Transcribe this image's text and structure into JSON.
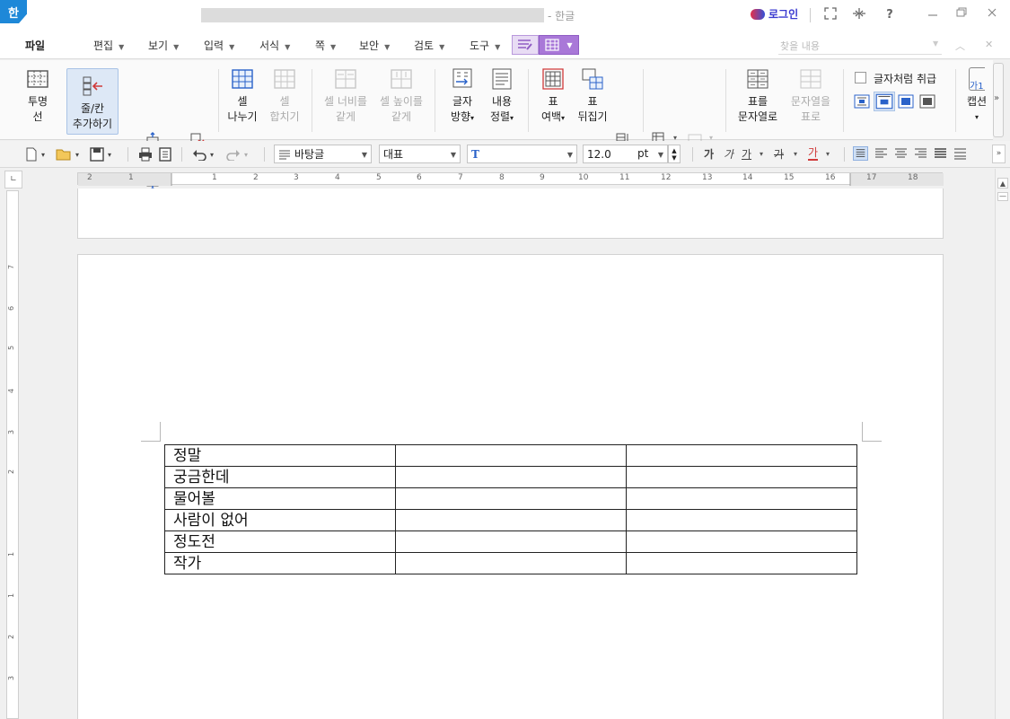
{
  "titlebar": {
    "app_icon": "한",
    "title_suffix": "- 한글",
    "login_label": "로그인",
    "buttons": [
      "fullscreen-icon",
      "pin-icon",
      "help-icon",
      "minimize-icon",
      "restore-icon",
      "close-icon"
    ],
    "help_glyph": "?"
  },
  "menu": {
    "file": "파일",
    "items": [
      "편집",
      "보기",
      "입력",
      "서식",
      "쪽",
      "보안",
      "검토",
      "도구"
    ],
    "search_placeholder": "찾을 내용"
  },
  "ribbon": {
    "transparent": [
      "투명",
      "선"
    ],
    "add_row_col": [
      "줄/칸",
      "추가하기"
    ],
    "split_cell": [
      "셀",
      "나누기"
    ],
    "merge_cell": [
      "셀",
      "합치기"
    ],
    "equal_width": [
      "셀 너비를",
      "같게"
    ],
    "equal_height": [
      "셀 높이를",
      "같게"
    ],
    "text_direction": [
      "글자",
      "방향"
    ],
    "content_align": [
      "내용",
      "정렬"
    ],
    "table_margin": [
      "표",
      "여백"
    ],
    "table_flip": [
      "표",
      "뒤집기"
    ],
    "table_to_text": [
      "표를",
      "문자열로"
    ],
    "text_to_table": [
      "문자열을",
      "표로"
    ],
    "treat_as_char": "글자처럼 취급",
    "caption": [
      "가1",
      "캡션"
    ]
  },
  "toolbar": {
    "style": "바탕글",
    "font_lang": "대표",
    "font_name": "",
    "font_size": "12.0",
    "font_unit": "pt",
    "fmt_bold": "가",
    "fmt_italic": "가",
    "fmt_underline": "가",
    "fmt_strike": "가",
    "fmt_color": "가"
  },
  "hruler": [
    "2",
    "1",
    "1",
    "2",
    "3",
    "4",
    "5",
    "6",
    "7",
    "8",
    "9",
    "10",
    "11",
    "12",
    "13",
    "14",
    "15",
    "16",
    "17",
    "18"
  ],
  "vruler": [
    "7",
    "6",
    "5",
    "4",
    "3",
    "2",
    "1",
    "1",
    "2",
    "3"
  ],
  "table": {
    "rows": [
      [
        "정말",
        "",
        ""
      ],
      [
        "궁금한데",
        "",
        ""
      ],
      [
        "물어볼",
        "",
        ""
      ],
      [
        "사람이 없어",
        "",
        ""
      ],
      [
        "정도전",
        "",
        ""
      ],
      [
        "작가",
        "",
        ""
      ]
    ]
  },
  "colors": {
    "accent_purple": "#a978d8",
    "app_blue": "#1e88d8",
    "active_blue": "#dde8f6"
  }
}
